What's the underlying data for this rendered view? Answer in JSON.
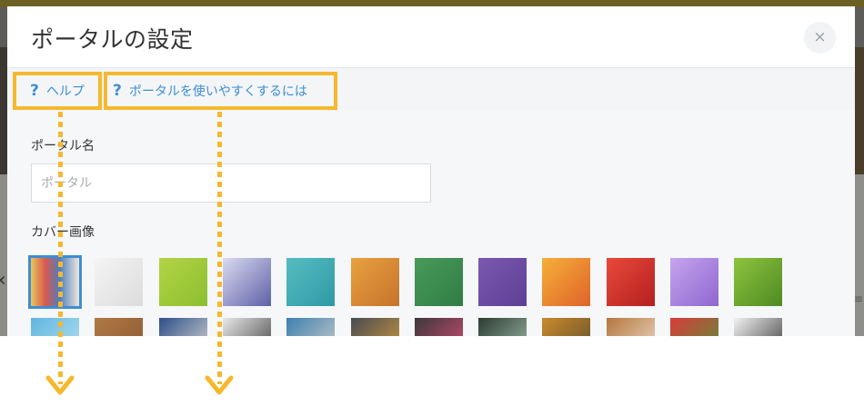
{
  "dialog": {
    "title": "ポータルの設定",
    "close_symbol": "×"
  },
  "help_links": [
    {
      "icon": "?",
      "label": "ヘルプ"
    },
    {
      "icon": "?",
      "label": "ポータルを使いやすくするには"
    }
  ],
  "form": {
    "name_label": "ポータル名",
    "name_placeholder": "ポータル",
    "name_value": "",
    "cover_label": "カバー画像"
  },
  "cover_images": {
    "selected_index": 0,
    "row1": [
      {
        "name": "colored-pencils",
        "colors": [
          "#e8c65a",
          "#d9594f",
          "#4d7fbf",
          "#f0e6dc"
        ]
      },
      {
        "name": "white-geometric",
        "colors": [
          "#f4f4f4",
          "#dcdcdc"
        ]
      },
      {
        "name": "green-lines",
        "colors": [
          "#b3d447",
          "#8cbf2e"
        ]
      },
      {
        "name": "purple-blue-gradient",
        "colors": [
          "#d9dbef",
          "#5d60a8"
        ]
      },
      {
        "name": "teal-water",
        "colors": [
          "#56bcc2",
          "#2f9aa5"
        ]
      },
      {
        "name": "orange-texture",
        "colors": [
          "#e8a140",
          "#c7732a"
        ]
      },
      {
        "name": "green-fabric",
        "colors": [
          "#4a9a5a",
          "#2f7d45"
        ]
      },
      {
        "name": "purple-fabric",
        "colors": [
          "#7a5ab0",
          "#5e3f96"
        ]
      },
      {
        "name": "orange-flower",
        "colors": [
          "#f5b03a",
          "#e0622a"
        ]
      },
      {
        "name": "red-flower",
        "colors": [
          "#e84a3a",
          "#b51f1f"
        ]
      },
      {
        "name": "lilac-flower",
        "colors": [
          "#c7a5ee",
          "#8e66cf"
        ]
      },
      {
        "name": "green-leaf-drops",
        "colors": [
          "#8dc43e",
          "#4e8a22"
        ]
      }
    ],
    "row2": [
      {
        "name": "blue-structure",
        "colors": [
          "#5fb6df",
          "#bfe3f2"
        ]
      },
      {
        "name": "wood-blocks",
        "colors": [
          "#b07a45",
          "#8a5530"
        ]
      },
      {
        "name": "moroccan-tiles",
        "colors": [
          "#2d4f8a",
          "#e8e2d6"
        ]
      },
      {
        "name": "desk-items",
        "colors": [
          "#e9e9ea",
          "#333333"
        ]
      },
      {
        "name": "stacked-books",
        "colors": [
          "#3e7fb0",
          "#d8d4cc"
        ]
      },
      {
        "name": "pens-papers",
        "colors": [
          "#4a4a52",
          "#d8a13a"
        ]
      },
      {
        "name": "chalkboard-doodles",
        "colors": [
          "#3a3a3a",
          "#e04b7a"
        ]
      },
      {
        "name": "lightbulbs",
        "colors": [
          "#2c3c34",
          "#a8c4b0"
        ]
      },
      {
        "name": "golden-blur",
        "colors": [
          "#c98a2e",
          "#5a4a2a"
        ]
      },
      {
        "name": "latte-art",
        "colors": [
          "#b5763d",
          "#efe4d4"
        ]
      },
      {
        "name": "strawberries",
        "colors": [
          "#d93a3a",
          "#4e9a3a"
        ]
      },
      {
        "name": "dark-object",
        "colors": [
          "#f2f2f2",
          "#2b2b2b"
        ]
      }
    ]
  },
  "colors": {
    "accent_blue": "#3e8ed0",
    "callout_yellow": "#f5b82e"
  }
}
